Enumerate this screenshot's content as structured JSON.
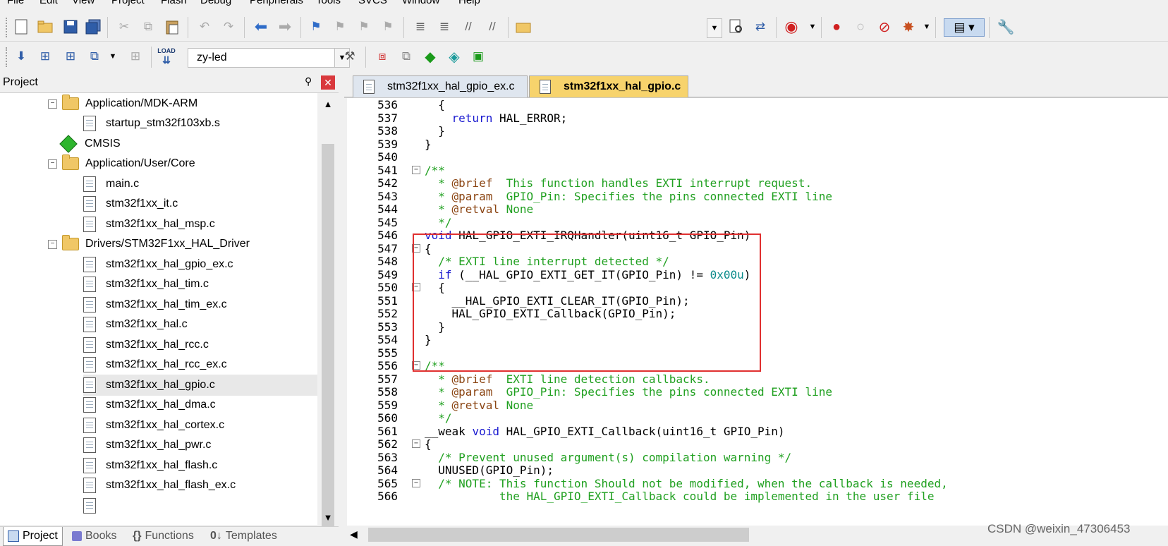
{
  "menu": [
    "File",
    "Edit",
    "View",
    "Project",
    "Flash",
    "Debug",
    "Peripherals",
    "Tools",
    "SVCS",
    "Window",
    "Help"
  ],
  "toolbar": {
    "target_name": "zy-led",
    "load_label": "LOAD"
  },
  "project_panel": {
    "title": "Project",
    "pin": "⚲",
    "close": "✕",
    "tree": [
      {
        "label": "Application/MDK-ARM",
        "type": "folder"
      },
      {
        "label": "startup_stm32f103xb.s",
        "type": "file"
      },
      {
        "label": "CMSIS",
        "type": "component"
      },
      {
        "label": "Application/User/Core",
        "type": "folder"
      },
      {
        "label": "main.c",
        "type": "file"
      },
      {
        "label": "stm32f1xx_it.c",
        "type": "file"
      },
      {
        "label": "stm32f1xx_hal_msp.c",
        "type": "file"
      },
      {
        "label": "Drivers/STM32F1xx_HAL_Driver",
        "type": "folder"
      },
      {
        "label": "stm32f1xx_hal_gpio_ex.c",
        "type": "file"
      },
      {
        "label": "stm32f1xx_hal_tim.c",
        "type": "file"
      },
      {
        "label": "stm32f1xx_hal_tim_ex.c",
        "type": "file"
      },
      {
        "label": "stm32f1xx_hal.c",
        "type": "file"
      },
      {
        "label": "stm32f1xx_hal_rcc.c",
        "type": "file"
      },
      {
        "label": "stm32f1xx_hal_rcc_ex.c",
        "type": "file"
      },
      {
        "label": "stm32f1xx_hal_gpio.c",
        "type": "file"
      },
      {
        "label": "stm32f1xx_hal_dma.c",
        "type": "file"
      },
      {
        "label": "stm32f1xx_hal_cortex.c",
        "type": "file"
      },
      {
        "label": "stm32f1xx_hal_pwr.c",
        "type": "file"
      },
      {
        "label": "stm32f1xx_hal_flash.c",
        "type": "file"
      },
      {
        "label": "stm32f1xx_hal_flash_ex.c",
        "type": "file"
      }
    ],
    "tabs": [
      "Project",
      "Books",
      "Functions",
      "Templates"
    ]
  },
  "editor": {
    "tabs": [
      {
        "label": "stm32f1xx_hal_gpio_ex.c",
        "active": false
      },
      {
        "label": "stm32f1xx_hal_gpio.c",
        "active": true
      }
    ],
    "lines": [
      {
        "n": "536",
        "t": "  {"
      },
      {
        "n": "537",
        "t": "    return HAL_ERROR;"
      },
      {
        "n": "538",
        "t": "  }"
      },
      {
        "n": "539",
        "t": "}"
      },
      {
        "n": "540",
        "t": ""
      },
      {
        "n": "541",
        "t": "/**"
      },
      {
        "n": "542",
        "t": "  * @brief  This function handles EXTI interrupt request."
      },
      {
        "n": "543",
        "t": "  * @param  GPIO_Pin: Specifies the pins connected EXTI line"
      },
      {
        "n": "544",
        "t": "  * @retval None"
      },
      {
        "n": "545",
        "t": "  */"
      },
      {
        "n": "546",
        "t": "void HAL_GPIO_EXTI_IRQHandler(uint16_t GPIO_Pin)"
      },
      {
        "n": "547",
        "t": "{"
      },
      {
        "n": "548",
        "t": "  /* EXTI line interrupt detected */"
      },
      {
        "n": "549",
        "t": "  if (__HAL_GPIO_EXTI_GET_IT(GPIO_Pin) != 0x00u)"
      },
      {
        "n": "550",
        "t": "  {"
      },
      {
        "n": "551",
        "t": "    __HAL_GPIO_EXTI_CLEAR_IT(GPIO_Pin);"
      },
      {
        "n": "552",
        "t": "    HAL_GPIO_EXTI_Callback(GPIO_Pin);"
      },
      {
        "n": "553",
        "t": "  }"
      },
      {
        "n": "554",
        "t": "}"
      },
      {
        "n": "555",
        "t": ""
      },
      {
        "n": "556",
        "t": "/**"
      },
      {
        "n": "557",
        "t": "  * @brief  EXTI line detection callbacks."
      },
      {
        "n": "558",
        "t": "  * @param  GPIO_Pin: Specifies the pins connected EXTI line"
      },
      {
        "n": "559",
        "t": "  * @retval None"
      },
      {
        "n": "560",
        "t": "  */"
      },
      {
        "n": "561",
        "t": "__weak void HAL_GPIO_EXTI_Callback(uint16_t GPIO_Pin)"
      },
      {
        "n": "562",
        "t": "{"
      },
      {
        "n": "563",
        "t": "  /* Prevent unused argument(s) compilation warning */"
      },
      {
        "n": "564",
        "t": "  UNUSED(GPIO_Pin);"
      },
      {
        "n": "565",
        "t": "  /* NOTE: This function Should not be modified, when the callback is needed,"
      },
      {
        "n": "566",
        "t": "           the HAL_GPIO_EXTI_Callback could be implemented in the user file"
      }
    ]
  },
  "watermark": "CSDN @weixin_47306453",
  "colors": {
    "keyword": "#1a1ad0",
    "comment": "#20a020",
    "doc_tag": "#8b4513",
    "number": "#0a8a8a",
    "highlight_box": "#e03030",
    "active_tab": "#f7d36c"
  }
}
